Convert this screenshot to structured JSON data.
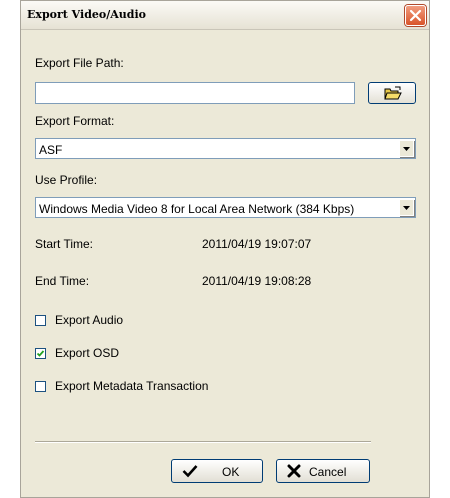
{
  "window": {
    "title": "Export Video/Audio",
    "close_icon": "close-icon"
  },
  "export_path": {
    "label": "Export File Path:",
    "value": "",
    "browse_icon": "folder-open-icon"
  },
  "export_format": {
    "label": "Export Format:",
    "selected": "ASF"
  },
  "use_profile": {
    "label": "Use Profile:",
    "selected": "Windows Media Video 8 for Local Area Network (384 Kbps)"
  },
  "times": {
    "start_label": "Start Time:",
    "start_value": "2011/04/19 19:07:07",
    "end_label": "End Time:",
    "end_value": "2011/04/19 19:08:28"
  },
  "options": {
    "export_audio": {
      "label": "Export Audio",
      "checked": false
    },
    "export_osd": {
      "label": "Export OSD",
      "checked": true
    },
    "export_metadata": {
      "label": "Export Metadata Transaction",
      "checked": false
    }
  },
  "buttons": {
    "ok_label": "OK",
    "cancel_label": "Cancel"
  },
  "colors": {
    "dialog_bg": "#ece9d8",
    "close_red": "#d9542a",
    "border_blue": "#7f9db9"
  }
}
